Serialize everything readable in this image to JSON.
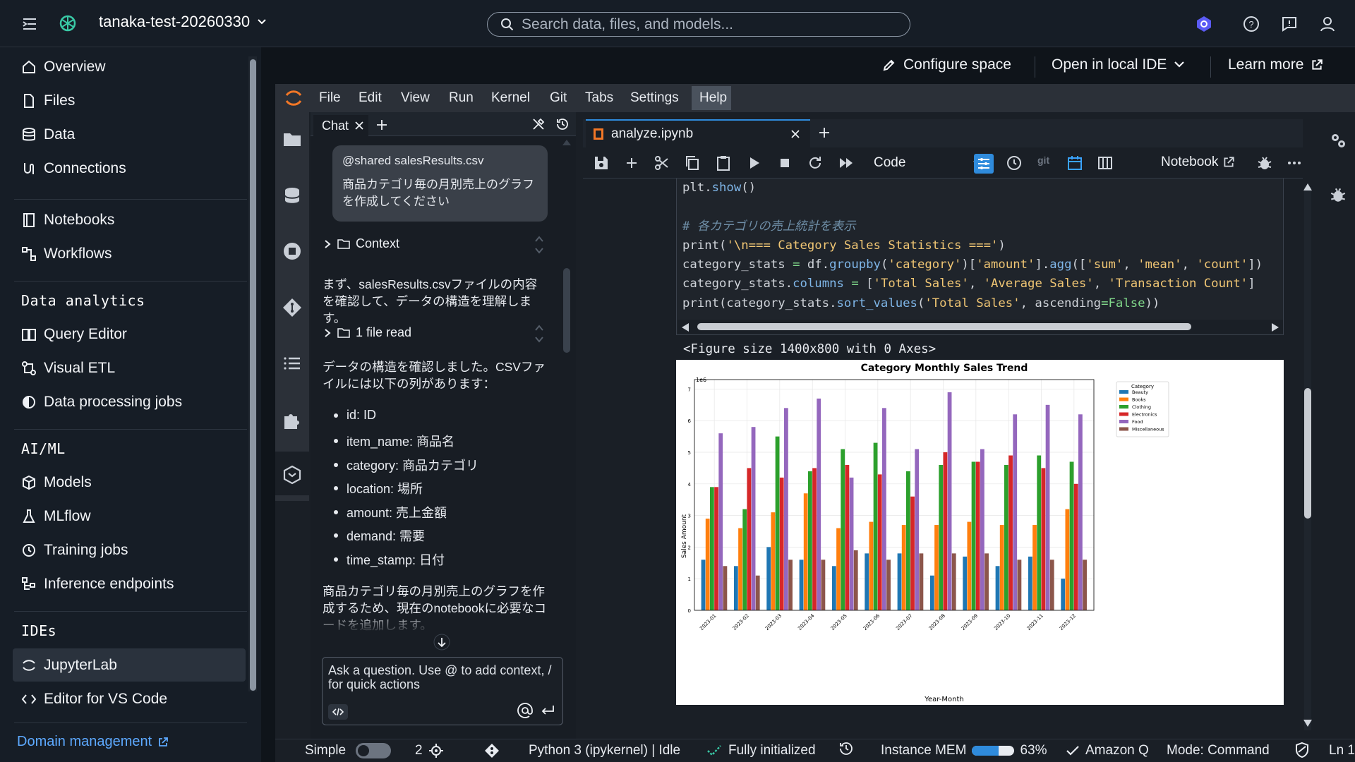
{
  "topbar": {
    "project": "tanaka-test-20260330",
    "search_placeholder": "Search data, files, and models..."
  },
  "sidebar": {
    "items": [
      {
        "label": "Overview",
        "icon": "home-icon"
      },
      {
        "label": "Files",
        "icon": "file-icon"
      },
      {
        "label": "Data",
        "icon": "database-icon"
      },
      {
        "label": "Connections",
        "icon": "connections-icon"
      },
      {
        "label": "Notebooks",
        "icon": "notebook-icon"
      },
      {
        "label": "Workflows",
        "icon": "workflow-icon"
      }
    ],
    "sections": {
      "analytics": {
        "title": "Data analytics",
        "items": [
          "Query Editor",
          "Visual ETL",
          "Data processing jobs"
        ]
      },
      "aiml": {
        "title": "AI/ML",
        "items": [
          "Models",
          "MLflow",
          "Training jobs",
          "Inference endpoints"
        ]
      },
      "ides": {
        "title": "IDEs",
        "items": [
          "JupyterLab",
          "Editor for VS Code"
        ]
      }
    },
    "domain_link": "Domain management"
  },
  "cfgbar": {
    "configure": "Configure space",
    "open_ide": "Open in local IDE",
    "learn": "Learn more"
  },
  "menubar": [
    "File",
    "Edit",
    "View",
    "Run",
    "Kernel",
    "Git",
    "Tabs",
    "Settings",
    "Help"
  ],
  "chat": {
    "tab_label": "Chat",
    "user_mention": "@shared salesResults.csv",
    "user_message": "商品カテゴリ毎の月別売上のグラフを作成してください",
    "context_label": "Context",
    "msg1": "まず、salesResults.csvファイルの内容を確認して、データの構造を理解します。",
    "file_read": "1 file read",
    "msg2": "データの構造を確認しました。CSVファイルには以下の列があります：",
    "columns": [
      "id: ID",
      "item_name: 商品名",
      "category: 商品カテゴリ",
      "location: 場所",
      "amount: 売上金額",
      "demand: 需要",
      "time_stamp: 日付"
    ],
    "msg3": "商品カテゴリ毎の月別売上のグラフを作成するため、現在のnotebookに必要なコードを追加します。",
    "input_placeholder": "Ask a question. Use @ to add context, / for quick actions"
  },
  "notebook": {
    "tab_label": "analyze.ipynb",
    "cell_type": "Code",
    "notebook_label": "Notebook",
    "output_text": "<Figure size 1400x800 with 0 Axes>"
  },
  "chart_data": {
    "type": "bar",
    "title": "Category Monthly Sales Trend",
    "xlabel": "Year-Month",
    "ylabel": "Sales Amount",
    "y_multiplier": "1e6",
    "ylim": [
      0,
      7.3
    ],
    "yticks": [
      0,
      1,
      2,
      3,
      4,
      5,
      6,
      7
    ],
    "legend_title": "Category",
    "legend_position": "top-right",
    "categories": [
      "2023-01",
      "2023-02",
      "2023-03",
      "2023-04",
      "2023-05",
      "2023-06",
      "2023-07",
      "2023-08",
      "2023-09",
      "2023-10",
      "2023-11",
      "2023-12"
    ],
    "series": [
      {
        "name": "Beauty",
        "color": "#1f77b4",
        "values": [
          1.6,
          1.4,
          2.0,
          1.6,
          1.4,
          1.8,
          1.8,
          1.1,
          1.7,
          1.4,
          1.7,
          1.0
        ]
      },
      {
        "name": "Books",
        "color": "#ff7f0e",
        "values": [
          2.9,
          2.6,
          3.1,
          3.7,
          2.6,
          2.8,
          2.7,
          2.7,
          2.8,
          2.7,
          2.7,
          3.2
        ]
      },
      {
        "name": "Clothing",
        "color": "#2ca02c",
        "values": [
          3.9,
          3.2,
          5.5,
          4.4,
          5.1,
          5.3,
          4.4,
          4.6,
          4.7,
          4.6,
          4.9,
          4.7
        ]
      },
      {
        "name": "Electronics",
        "color": "#d62728",
        "values": [
          3.9,
          4.5,
          4.2,
          4.5,
          4.6,
          4.3,
          3.6,
          5.0,
          4.7,
          4.9,
          4.5,
          4.0
        ]
      },
      {
        "name": "Food",
        "color": "#9467bd",
        "values": [
          5.6,
          5.8,
          6.4,
          6.7,
          4.2,
          6.4,
          5.1,
          6.9,
          5.1,
          6.2,
          6.5,
          6.2
        ]
      },
      {
        "name": "Miscellaneous",
        "color": "#8c564b",
        "values": [
          1.4,
          1.1,
          1.6,
          1.6,
          1.9,
          1.6,
          1.8,
          1.8,
          1.8,
          1.6,
          1.6,
          1.6
        ]
      }
    ]
  },
  "status": {
    "mode_simple": "Simple",
    "count": "2",
    "kernel": "Python 3 (ipykernel) | Idle",
    "init": "Fully initialized",
    "mem_label": "Instance MEM",
    "mem_pct": "63%",
    "mem_fraction": 0.63,
    "amazonq": "Amazon Q",
    "mode": "Mode: Command",
    "ln": "Ln 1"
  }
}
